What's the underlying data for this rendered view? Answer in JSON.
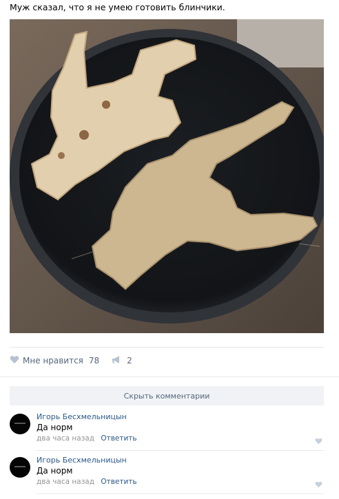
{
  "post": {
    "text": "Муж сказал, что я не умею готовить блинчики."
  },
  "photo": {
    "description_icon": "pancake-pan-photo"
  },
  "actions": {
    "like_label": "Мне нравится",
    "like_count": "78",
    "share_count": "2",
    "like_icon": "heart-icon",
    "share_icon": "megaphone-icon"
  },
  "comments_toggle": {
    "label": "Скрыть комментарии"
  },
  "comments": [
    {
      "author": "Игорь Бесхмельницын",
      "text": "Да норм",
      "time": "два часа назад",
      "reply": "Ответить"
    },
    {
      "author": "Игорь Бесхмельницын",
      "text": "Да норм",
      "time": "два часа назад",
      "reply": "Ответить"
    }
  ],
  "colors": {
    "link": "#2a5885",
    "muted": "#55677d",
    "divider": "#e7e8ec",
    "toggle_bg": "#f0f2f5"
  }
}
